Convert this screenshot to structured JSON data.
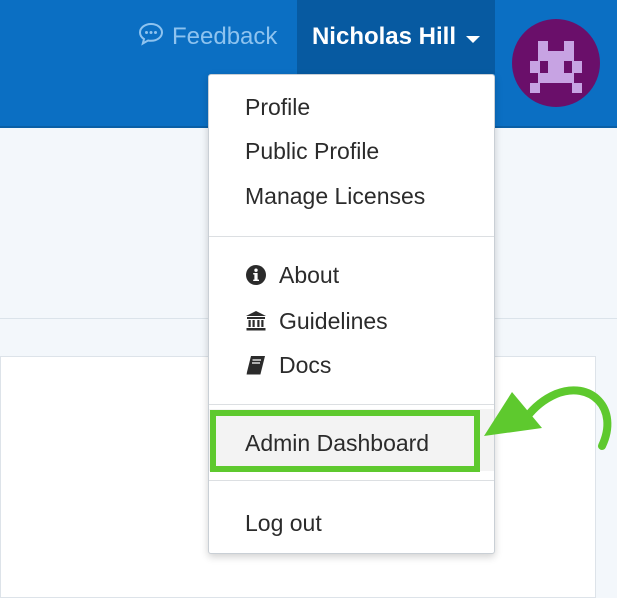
{
  "header": {
    "feedback_label": "Feedback",
    "user_name": "Nicholas Hill"
  },
  "menu": {
    "items": [
      {
        "label": "Profile"
      },
      {
        "label": "Public Profile"
      },
      {
        "label": "Manage Licenses"
      },
      {
        "label": "About",
        "icon": "info-circle-icon"
      },
      {
        "label": "Guidelines",
        "icon": "institution-icon"
      },
      {
        "label": "Docs",
        "icon": "book-icon"
      },
      {
        "label": "Admin Dashboard"
      },
      {
        "label": "Log out"
      }
    ]
  },
  "colors": {
    "header_bg": "#0b6fc3",
    "user_button_bg": "#075aa1",
    "avatar_bg": "#6a0f6a",
    "avatar_fg": "#c7a3e3",
    "highlight_annotation": "#5ec92e"
  }
}
